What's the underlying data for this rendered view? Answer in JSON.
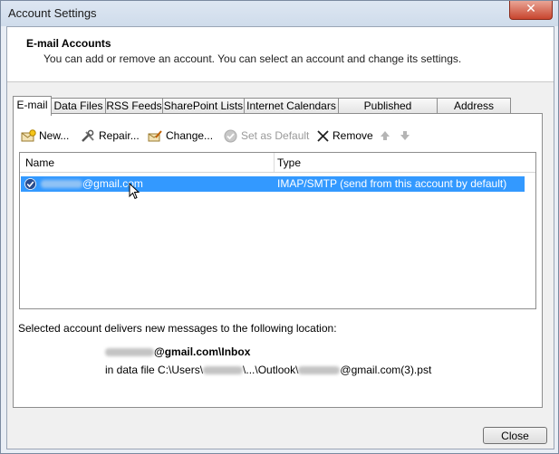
{
  "window": {
    "title": "Account Settings"
  },
  "header": {
    "title": "E-mail Accounts",
    "description": "You can add or remove an account. You can select an account and change its settings."
  },
  "tabs": [
    {
      "label": "E-mail",
      "active": true
    },
    {
      "label": "Data Files"
    },
    {
      "label": "RSS Feeds"
    },
    {
      "label": "SharePoint Lists"
    },
    {
      "label": "Internet Calendars"
    },
    {
      "label": "Published Calendars"
    },
    {
      "label": "Address Books"
    }
  ],
  "toolbar": {
    "new_label": "New...",
    "repair_label": "Repair...",
    "change_label": "Change...",
    "set_default_label": "Set as Default",
    "remove_label": "Remove"
  },
  "list": {
    "col_name": "Name",
    "col_type": "Type",
    "rows": [
      {
        "name_suffix": "@gmail.com",
        "type": "IMAP/SMTP (send from this account by default)"
      }
    ]
  },
  "location": {
    "label": "Selected account delivers new messages to the following location:",
    "folder_suffix": "@gmail.com\\Inbox",
    "file_prefix": "in data file C:\\Users\\",
    "file_middle": "\\...\\Outlook\\",
    "file_suffix": "@gmail.com(3).pst"
  },
  "buttons": {
    "close_label": "Close"
  },
  "colors": {
    "selection": "#3399ff",
    "titlebar": "#d6e2ef",
    "close_button": "#c8452e"
  },
  "icons": [
    "new-account-icon",
    "repair-icon",
    "change-icon",
    "set-default-icon",
    "remove-icon",
    "move-up-icon",
    "move-down-icon",
    "default-account-check-icon",
    "mouse-cursor-icon"
  ]
}
